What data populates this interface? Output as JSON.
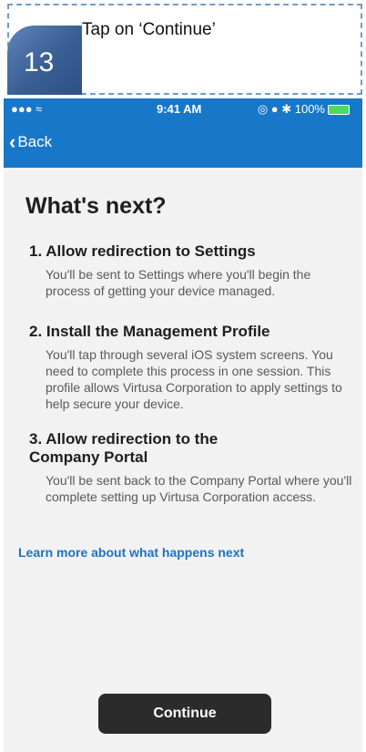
{
  "instruction": {
    "step_number": "13",
    "text": "Tap on ‘Continue’"
  },
  "status_bar": {
    "signal": "••• ◉",
    "time": "9:41 AM",
    "right": "◎ ● ✱ 100%"
  },
  "nav": {
    "back_label": "Back"
  },
  "page": {
    "title": "What's next?",
    "steps": [
      {
        "title": "1. Allow redirection to Settings",
        "body": "You'll be sent to Settings where you'll begin the process of getting your device managed."
      },
      {
        "title": "2. Install the Management Profile",
        "body": "You'll tap through several iOS system screens. You need to complete this process in one session. This profile allows Virtusa Corporation to apply settings to help secure your device."
      },
      {
        "title": "3. Allow redirection to the Company Portal",
        "body": "You'll be sent back to the Company Portal where you'll complete setting up Virtusa Corporation access."
      }
    ],
    "learn_more": "Learn more about what happens next",
    "continue_label": "Continue"
  },
  "colors": {
    "accent": "#1877c9",
    "badge": "#385e94",
    "button": "#2b2b2b"
  }
}
